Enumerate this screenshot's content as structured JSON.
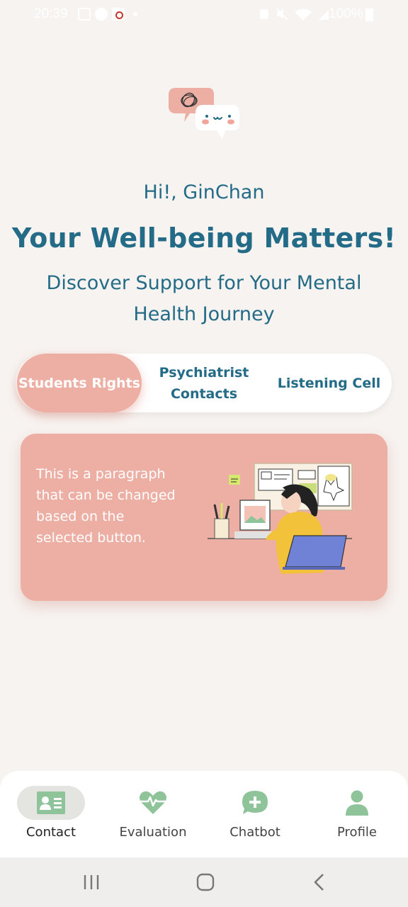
{
  "status_bar": {
    "time": "20:39",
    "battery": "100%"
  },
  "header": {
    "greeting": "Hi!, GinChan",
    "headline": "Your Well-being Matters!",
    "subheadline": "Discover Support for Your Mental Health Journey"
  },
  "tabs": [
    {
      "label": "Students Rights",
      "active": true
    },
    {
      "label": "Psychiatrist Contacts",
      "active": false
    },
    {
      "label": "Listening Cell",
      "active": false
    }
  ],
  "card": {
    "paragraph": "This is a paragraph that can be changed based on the selected button."
  },
  "bottom_nav": [
    {
      "label": "Contact",
      "icon": "contact-card-icon",
      "active": true
    },
    {
      "label": "Evaluation",
      "icon": "heart-pulse-icon",
      "active": false
    },
    {
      "label": "Chatbot",
      "icon": "chat-plus-icon",
      "active": false
    },
    {
      "label": "Profile",
      "icon": "person-icon",
      "active": false
    }
  ],
  "colors": {
    "primary_text": "#236b87",
    "accent_pink": "#edaea4",
    "icon_green": "#8fc39a",
    "background": "#f7f3f0"
  }
}
